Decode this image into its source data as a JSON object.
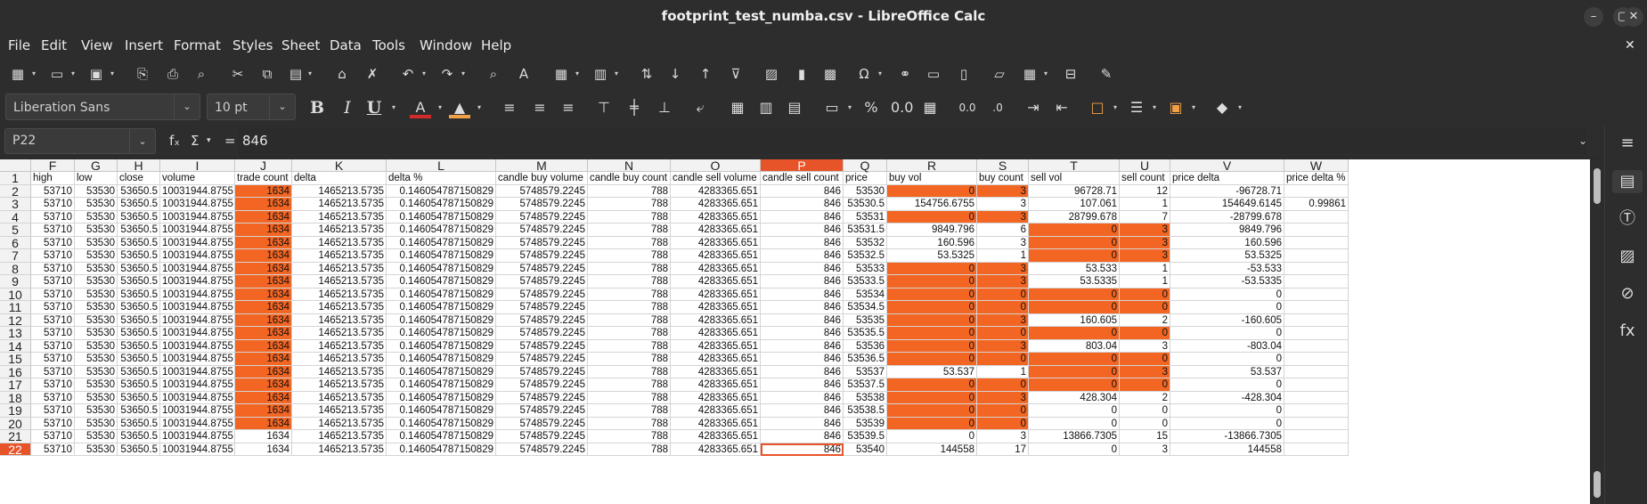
{
  "window": {
    "title": "footprint_test_numba.csv - LibreOffice Calc",
    "minimize_label": "–",
    "maximize_label": "▢",
    "close_label": "✕"
  },
  "menu": [
    "File",
    "Edit",
    "View",
    "Insert",
    "Format",
    "Styles",
    "Sheet",
    "Data",
    "Tools",
    "Window",
    "Help"
  ],
  "menu_close": "✕",
  "toolbar": {
    "font_name": "Liberation Sans",
    "font_size": "10 pt",
    "bold": "B",
    "italic": "I",
    "underline": "U",
    "percent": "%",
    "decimals": "0.0"
  },
  "formula_bar": {
    "cell_ref": "P22",
    "fx": "fₓ",
    "sigma": "Σ",
    "equals": "=",
    "value": "846"
  },
  "colors": {
    "highlight": "#f26522",
    "selection": "#e8542a",
    "chrome": "#2d2d2d"
  },
  "sheet": {
    "columns": [
      "F",
      "G",
      "H",
      "I",
      "J",
      "K",
      "L",
      "M",
      "N",
      "O",
      "P",
      "Q",
      "R",
      "S",
      "T",
      "U",
      "V",
      "W"
    ],
    "selected_column": "P",
    "row_numbers": [
      "1",
      "2",
      "3",
      "4",
      "5",
      "6",
      "7",
      "8",
      "9",
      "10",
      "11",
      "12",
      "13",
      "14",
      "15",
      "16",
      "17",
      "18",
      "19",
      "20",
      "21",
      "22"
    ],
    "selected_row": "22",
    "header": [
      "high",
      "low",
      "close",
      "volume",
      "trade count",
      "delta",
      "delta %",
      "candle buy volume",
      "candle buy count",
      "candle sell volume",
      "candle sell count",
      "price",
      "buy vol",
      "buy count",
      "sell vol",
      "sell count",
      "price delta",
      "price delta %"
    ],
    "rows": [
      [
        "53710",
        "53530",
        "53650.5",
        "10031944.8755",
        "1634",
        "1465213.5735",
        "0.146054787150829",
        "5748579.2245",
        "788",
        "4283365.651",
        "846",
        "53530",
        "0",
        "3",
        "96728.71",
        "12",
        "-96728.71",
        ""
      ],
      [
        "53710",
        "53530",
        "53650.5",
        "10031944.8755",
        "1634",
        "1465213.5735",
        "0.146054787150829",
        "5748579.2245",
        "788",
        "4283365.651",
        "846",
        "53530.5",
        "154756.6755",
        "3",
        "107.061",
        "1",
        "154649.6145",
        "0.99861"
      ],
      [
        "53710",
        "53530",
        "53650.5",
        "10031944.8755",
        "1634",
        "1465213.5735",
        "0.146054787150829",
        "5748579.2245",
        "788",
        "4283365.651",
        "846",
        "53531",
        "0",
        "3",
        "28799.678",
        "7",
        "-28799.678",
        ""
      ],
      [
        "53710",
        "53530",
        "53650.5",
        "10031944.8755",
        "1634",
        "1465213.5735",
        "0.146054787150829",
        "5748579.2245",
        "788",
        "4283365.651",
        "846",
        "53531.5",
        "9849.796",
        "6",
        "0",
        "3",
        "9849.796",
        ""
      ],
      [
        "53710",
        "53530",
        "53650.5",
        "10031944.8755",
        "1634",
        "1465213.5735",
        "0.146054787150829",
        "5748579.2245",
        "788",
        "4283365.651",
        "846",
        "53532",
        "160.596",
        "3",
        "0",
        "3",
        "160.596",
        ""
      ],
      [
        "53710",
        "53530",
        "53650.5",
        "10031944.8755",
        "1634",
        "1465213.5735",
        "0.146054787150829",
        "5748579.2245",
        "788",
        "4283365.651",
        "846",
        "53532.5",
        "53.5325",
        "1",
        "0",
        "3",
        "53.5325",
        ""
      ],
      [
        "53710",
        "53530",
        "53650.5",
        "10031944.8755",
        "1634",
        "1465213.5735",
        "0.146054787150829",
        "5748579.2245",
        "788",
        "4283365.651",
        "846",
        "53533",
        "0",
        "3",
        "53.533",
        "1",
        "-53.533",
        ""
      ],
      [
        "53710",
        "53530",
        "53650.5",
        "10031944.8755",
        "1634",
        "1465213.5735",
        "0.146054787150829",
        "5748579.2245",
        "788",
        "4283365.651",
        "846",
        "53533.5",
        "0",
        "3",
        "53.5335",
        "1",
        "-53.5335",
        ""
      ],
      [
        "53710",
        "53530",
        "53650.5",
        "10031944.8755",
        "1634",
        "1465213.5735",
        "0.146054787150829",
        "5748579.2245",
        "788",
        "4283365.651",
        "846",
        "53534",
        "0",
        "0",
        "0",
        "0",
        "0",
        ""
      ],
      [
        "53710",
        "53530",
        "53650.5",
        "10031944.8755",
        "1634",
        "1465213.5735",
        "0.146054787150829",
        "5748579.2245",
        "788",
        "4283365.651",
        "846",
        "53534.5",
        "0",
        "0",
        "0",
        "0",
        "0",
        ""
      ],
      [
        "53710",
        "53530",
        "53650.5",
        "10031944.8755",
        "1634",
        "1465213.5735",
        "0.146054787150829",
        "5748579.2245",
        "788",
        "4283365.651",
        "846",
        "53535",
        "0",
        "3",
        "160.605",
        "2",
        "-160.605",
        ""
      ],
      [
        "53710",
        "53530",
        "53650.5",
        "10031944.8755",
        "1634",
        "1465213.5735",
        "0.146054787150829",
        "5748579.2245",
        "788",
        "4283365.651",
        "846",
        "53535.5",
        "0",
        "0",
        "0",
        "0",
        "0",
        ""
      ],
      [
        "53710",
        "53530",
        "53650.5",
        "10031944.8755",
        "1634",
        "1465213.5735",
        "0.146054787150829",
        "5748579.2245",
        "788",
        "4283365.651",
        "846",
        "53536",
        "0",
        "3",
        "803.04",
        "3",
        "-803.04",
        ""
      ],
      [
        "53710",
        "53530",
        "53650.5",
        "10031944.8755",
        "1634",
        "1465213.5735",
        "0.146054787150829",
        "5748579.2245",
        "788",
        "4283365.651",
        "846",
        "53536.5",
        "0",
        "0",
        "0",
        "0",
        "0",
        ""
      ],
      [
        "53710",
        "53530",
        "53650.5",
        "10031944.8755",
        "1634",
        "1465213.5735",
        "0.146054787150829",
        "5748579.2245",
        "788",
        "4283365.651",
        "846",
        "53537",
        "53.537",
        "1",
        "0",
        "3",
        "53.537",
        ""
      ],
      [
        "53710",
        "53530",
        "53650.5",
        "10031944.8755",
        "1634",
        "1465213.5735",
        "0.146054787150829",
        "5748579.2245",
        "788",
        "4283365.651",
        "846",
        "53537.5",
        "0",
        "0",
        "0",
        "0",
        "0",
        ""
      ],
      [
        "53710",
        "53530",
        "53650.5",
        "10031944.8755",
        "1634",
        "1465213.5735",
        "0.146054787150829",
        "5748579.2245",
        "788",
        "4283365.651",
        "846",
        "53538",
        "0",
        "3",
        "428.304",
        "2",
        "-428.304",
        ""
      ],
      [
        "53710",
        "53530",
        "53650.5",
        "10031944.8755",
        "1634",
        "1465213.5735",
        "0.146054787150829",
        "5748579.2245",
        "788",
        "4283365.651",
        "846",
        "53538.5",
        "0",
        "0",
        "0",
        "0",
        "0",
        ""
      ],
      [
        "53710",
        "53530",
        "53650.5",
        "10031944.8755",
        "1634",
        "1465213.5735",
        "0.146054787150829",
        "5748579.2245",
        "788",
        "4283365.651",
        "846",
        "53539",
        "0",
        "0",
        "0",
        "0",
        "0",
        ""
      ],
      [
        "53710",
        "53530",
        "53650.5",
        "10031944.8755",
        "1634",
        "1465213.5735",
        "0.146054787150829",
        "5748579.2245",
        "788",
        "4283365.651",
        "846",
        "53539.5",
        "0",
        "3",
        "13866.7305",
        "15",
        "-13866.7305",
        ""
      ],
      [
        "53710",
        "53530",
        "53650.5",
        "10031944.8755",
        "1634",
        "1465213.5735",
        "0.146054787150829",
        "5748579.2245",
        "788",
        "4283365.651",
        "846",
        "53540",
        "144558",
        "17",
        "0",
        "3",
        "144558",
        ""
      ]
    ],
    "highlights": [
      [
        0,
        12
      ],
      [
        0,
        13
      ],
      [
        2,
        12
      ],
      [
        2,
        13
      ],
      [
        3,
        14
      ],
      [
        3,
        15
      ],
      [
        4,
        14
      ],
      [
        4,
        15
      ],
      [
        5,
        14
      ],
      [
        5,
        15
      ],
      [
        6,
        12
      ],
      [
        6,
        13
      ],
      [
        7,
        12
      ],
      [
        7,
        13
      ],
      [
        8,
        12
      ],
      [
        8,
        13
      ],
      [
        8,
        14
      ],
      [
        8,
        15
      ],
      [
        9,
        12
      ],
      [
        9,
        13
      ],
      [
        9,
        14
      ],
      [
        9,
        15
      ],
      [
        10,
        12
      ],
      [
        10,
        13
      ],
      [
        11,
        12
      ],
      [
        11,
        13
      ],
      [
        11,
        14
      ],
      [
        11,
        15
      ],
      [
        12,
        12
      ],
      [
        12,
        13
      ],
      [
        13,
        12
      ],
      [
        13,
        13
      ],
      [
        13,
        14
      ],
      [
        13,
        15
      ],
      [
        14,
        14
      ],
      [
        14,
        15
      ],
      [
        15,
        12
      ],
      [
        15,
        13
      ],
      [
        15,
        14
      ],
      [
        15,
        15
      ],
      [
        16,
        12
      ],
      [
        16,
        13
      ],
      [
        17,
        12
      ],
      [
        17,
        13
      ],
      [
        18,
        12
      ],
      [
        18,
        13
      ]
    ],
    "highlight_column_j_rows": [
      0,
      1,
      2,
      3,
      4,
      5,
      6,
      7,
      8,
      9,
      10,
      11,
      12,
      13,
      14,
      15,
      16,
      17,
      18
    ]
  }
}
